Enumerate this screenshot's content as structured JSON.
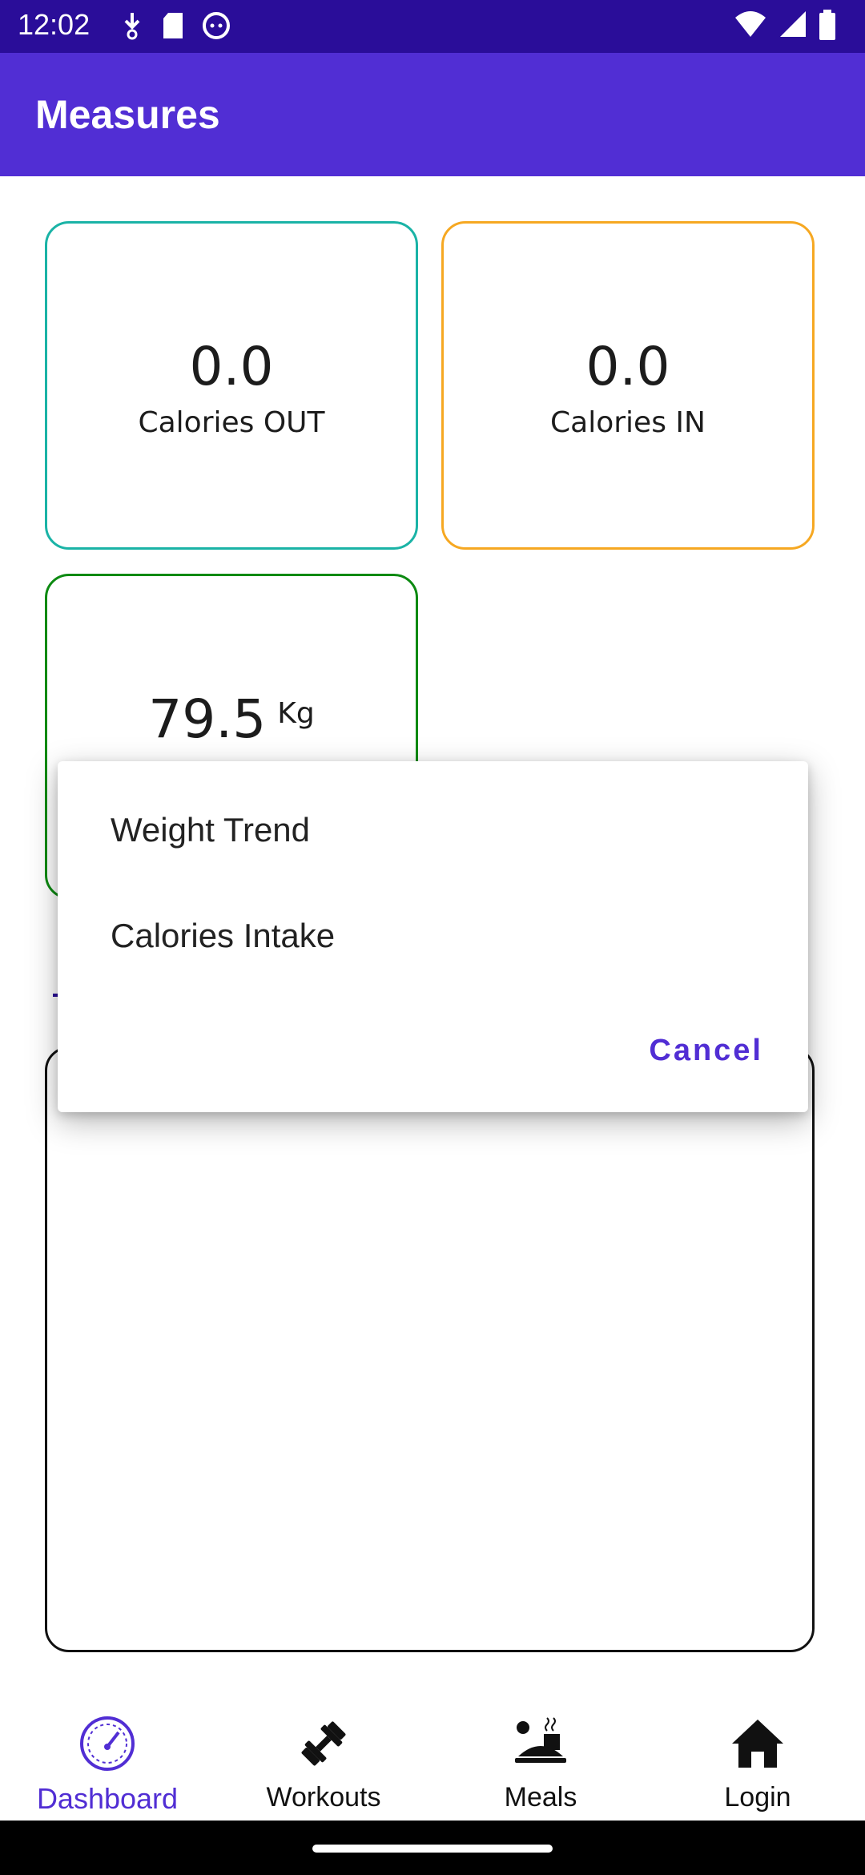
{
  "status_bar": {
    "time": "12:02",
    "left_icons": [
      "download-icon",
      "sd-card-icon",
      "cat-app-icon"
    ],
    "right_icons": [
      "wifi-icon",
      "signal-icon",
      "battery-icon"
    ]
  },
  "app_bar": {
    "title": "Measures",
    "color": "#512ed4"
  },
  "cards": {
    "calories_out": {
      "value": "0.0",
      "label": "Calories OUT",
      "border_color": "#1ab3a6"
    },
    "calories_in": {
      "value": "0.0",
      "label": "Calories IN",
      "border_color": "#f6a822"
    },
    "weight": {
      "value": "79.5",
      "unit": "Kg",
      "border_color": "#0d8a12"
    }
  },
  "dialog": {
    "items": [
      {
        "label": "Weight Trend"
      },
      {
        "label": "Calories Intake"
      }
    ],
    "cancel_label": "Cancel"
  },
  "bottom_nav": {
    "items": [
      {
        "label": "Dashboard",
        "icon": "dashboard-icon",
        "active": true
      },
      {
        "label": "Workouts",
        "icon": "dumbbell-icon",
        "active": false
      },
      {
        "label": "Meals",
        "icon": "meal-icon",
        "active": false
      },
      {
        "label": "Login",
        "icon": "home-icon",
        "active": false
      }
    ]
  }
}
